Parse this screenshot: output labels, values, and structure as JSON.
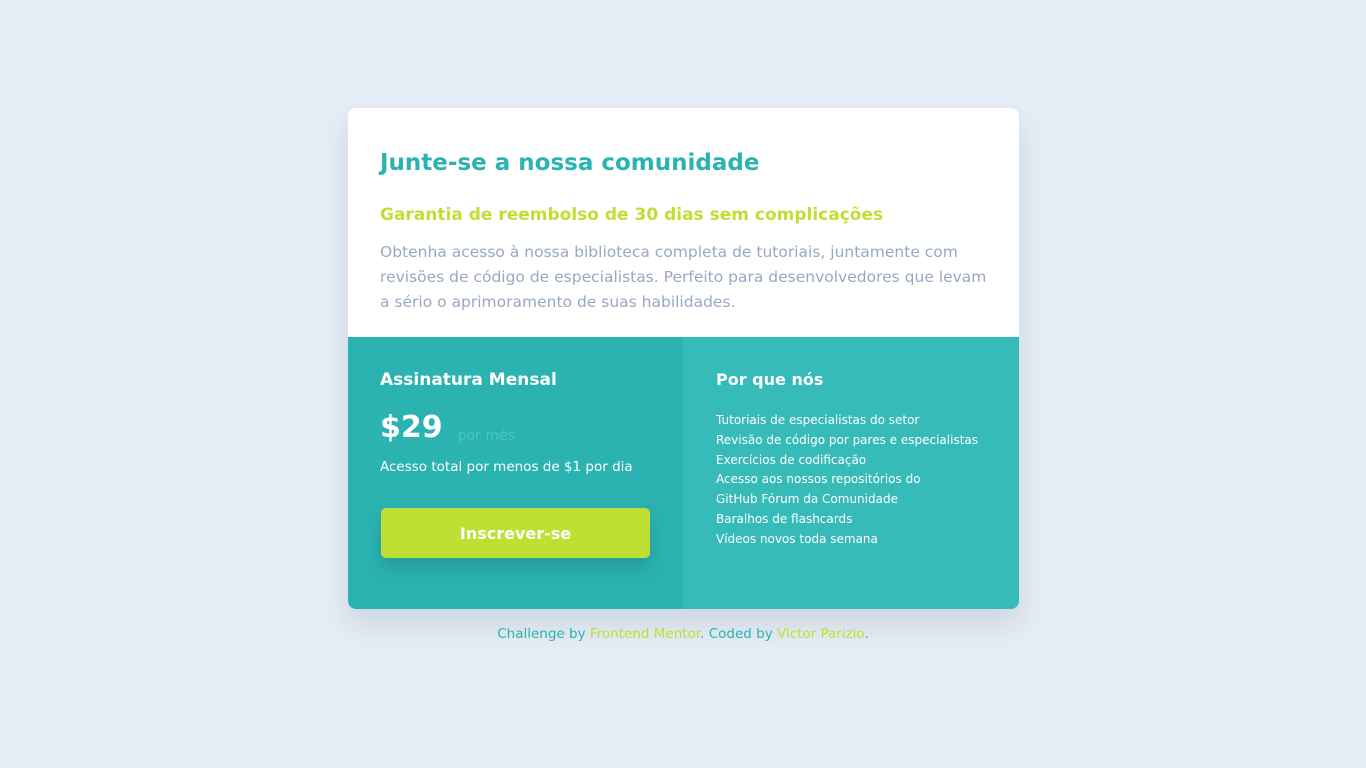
{
  "card": {
    "title": "Junte-se a nossa comunidade",
    "guarantee": "Garantia de reembolso de 30 dias sem complicações",
    "description": "Obtenha acesso à nossa biblioteca completa de tutoriais, juntamente com revisões de código de especialistas. Perfeito para desenvolvedores que levam a sério o aprimoramento de suas habilidades."
  },
  "subscription": {
    "title": "Assinatura Mensal",
    "price": "$29",
    "per": "por mês",
    "access": "Acesso total por menos de $1 por dia",
    "button_label": "Inscrever-se"
  },
  "why": {
    "title": "Por que nós",
    "items": [
      "Tutoriais de especialistas do setor",
      "Revisão de código por pares e especialistas",
      "Exercícios de codificação",
      "Acesso aos nossos repositórios do",
      "GitHub Fórum da Comunidade",
      "Baralhos de flashcards",
      "Vídeos novos toda semana"
    ]
  },
  "footer": {
    "challenge_by": "Challenge by ",
    "frontend_mentor": "Frontend Mentor",
    "coded_by": ". Coded by ",
    "author": "Victor Parizio",
    "end": "."
  },
  "colors": {
    "background": "#e5edf5",
    "accent_cyan": "#2bb3b1",
    "accent_cyan_light": "#36bbb8",
    "accent_lime": "#bfdf32",
    "text_muted": "#98a8c4"
  }
}
